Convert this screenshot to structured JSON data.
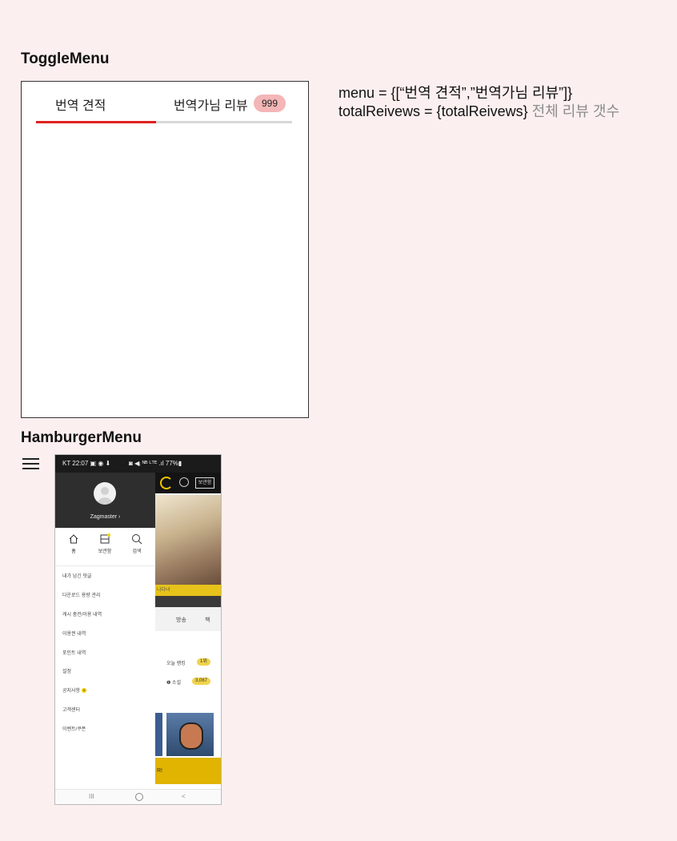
{
  "toggle_section": {
    "title": "ToggleMenu",
    "tabs": [
      {
        "label": "번역 견적"
      },
      {
        "label": "번역가님 리뷰",
        "badge": "999"
      }
    ],
    "note_line1": "menu = {[“번역 견적”,”번역가님 리뷰”]}",
    "note_line2_code": "totalReivews = {totalReivews}",
    "note_line2_desc": "전체 리뷰 갯수",
    "colors": {
      "active_underline": "#e02020",
      "badge_bg": "#f4b6b6",
      "page_bg": "#fcefef"
    }
  },
  "hamburger_section": {
    "title": "HamburgerMenu",
    "icon": "hamburger-icon",
    "phone": {
      "status_left": "KT 22:07 ▣ ◉ ⬇",
      "status_right": "◙ ◀ᵢ ᴺᴮ ᴸᵀᴱ .ıl 77%▮",
      "username": "Zagmaster ›",
      "quick_actions": [
        {
          "label": "홈",
          "icon": "home-icon"
        },
        {
          "label": "보관함",
          "icon": "storage-icon"
        },
        {
          "label": "검색",
          "icon": "search-icon"
        }
      ],
      "menu_items": [
        "내가 남긴 댓글",
        "다운로드 용량 관리",
        "캐시 충전/이용 내역",
        "이용권 내역",
        "포인트 내역",
        "설정",
        "공지사항",
        "고객센터",
        "이벤트/쿠폰"
      ],
      "notice_badge": "N",
      "background": {
        "store_button": "보관함",
        "tab_broadcast": "방송",
        "tab_book": "책",
        "today_ranking": "오늘 랭킹",
        "rank_chip": "1위",
        "novel_label": "❶ 소설",
        "novel_count": "3,067",
        "yellow_strip": "나다녀",
        "banner_text": "R!"
      },
      "nav": {
        "recent": "III",
        "back": "<"
      }
    }
  }
}
